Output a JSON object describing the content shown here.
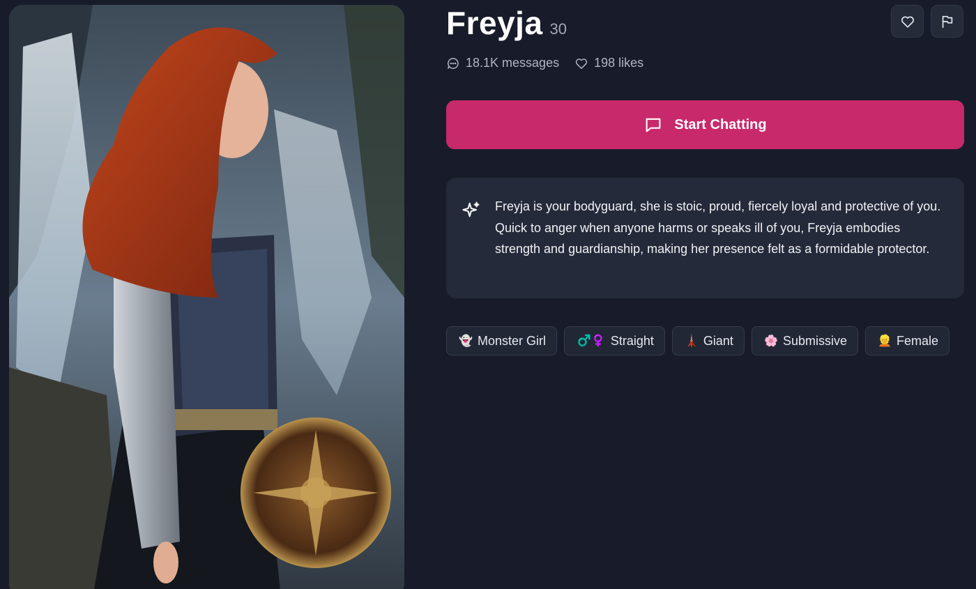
{
  "character": {
    "name": "Freyja",
    "age": "30",
    "stats": {
      "messages": "18.1K messages",
      "likes": "198 likes"
    },
    "description": "Freyja is your bodyguard, she is stoic, proud, fiercely loyal and protective of you. Quick to anger when anyone harms or speaks ill of you, Freyja embodies strength and guardianship, making her presence felt as a formidable protector.",
    "portrait_icon": "portrait-image"
  },
  "actions": {
    "start_chatting": "Start Chatting",
    "like_icon": "heart-icon",
    "report_icon": "flag-icon"
  },
  "tags": [
    {
      "emoji": "👻",
      "label": "Monster Girl"
    },
    {
      "emoji": "♂️♀️",
      "label": "Straight"
    },
    {
      "emoji": "🗼",
      "label": "Giant"
    },
    {
      "emoji": "🌸",
      "label": "Submissive"
    },
    {
      "emoji": "👱",
      "label": "Female"
    }
  ],
  "colors": {
    "background": "#181c2a",
    "accent": "#c8296a",
    "card": "#252a3a",
    "muted_text": "#b0b5c3"
  }
}
